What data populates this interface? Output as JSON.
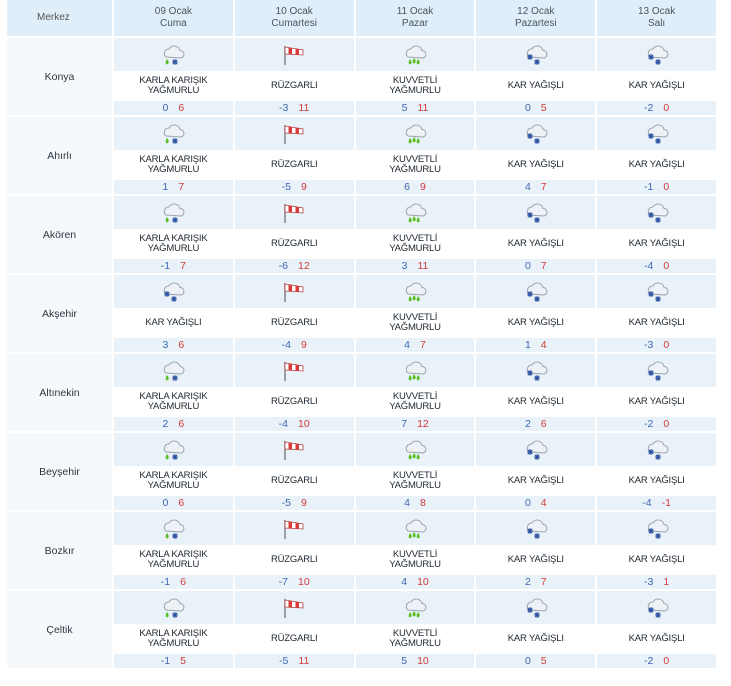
{
  "header": {
    "merkez_label": "Merkez",
    "days": [
      {
        "date": "09 Ocak",
        "weekday": "Cuma"
      },
      {
        "date": "10 Ocak",
        "weekday": "Cumartesi"
      },
      {
        "date": "11 Ocak",
        "weekday": "Pazar"
      },
      {
        "date": "12 Ocak",
        "weekday": "Pazartesi"
      },
      {
        "date": "13 Ocak",
        "weekday": "Salı"
      }
    ]
  },
  "colors": {
    "header_bg": "#dfeef8",
    "row_bg": "#e9f2f9",
    "min_temp": "#3d67b0",
    "max_temp": "#d23a3a",
    "rain_green": "#5cbf2a",
    "snow_blue": "#2a4fa0",
    "windsock_red": "#d93a3a"
  },
  "cities": [
    {
      "name": "Konya",
      "days": [
        {
          "icon": "sleet-icon",
          "label": "KARLA KARIŞIK YAĞMURLU",
          "min": "0",
          "max": "6"
        },
        {
          "icon": "windsock-icon",
          "label": "RÜZGARLI",
          "min": "-3",
          "max": "11"
        },
        {
          "icon": "heavy-rain-icon",
          "label": "KUVVETLİ YAĞMURLU",
          "min": "5",
          "max": "11"
        },
        {
          "icon": "snow-icon",
          "label": "KAR YAĞIŞLI",
          "min": "0",
          "max": "5"
        },
        {
          "icon": "snow-icon",
          "label": "KAR YAĞIŞLI",
          "min": "-2",
          "max": "0"
        }
      ]
    },
    {
      "name": "Ahırlı",
      "days": [
        {
          "icon": "sleet-icon",
          "label": "KARLA KARIŞIK YAĞMURLU",
          "min": "1",
          "max": "7"
        },
        {
          "icon": "windsock-icon",
          "label": "RÜZGARLI",
          "min": "-5",
          "max": "9"
        },
        {
          "icon": "heavy-rain-icon",
          "label": "KUVVETLİ YAĞMURLU",
          "min": "6",
          "max": "9"
        },
        {
          "icon": "snow-icon",
          "label": "KAR YAĞIŞLI",
          "min": "4",
          "max": "7"
        },
        {
          "icon": "snow-icon",
          "label": "KAR YAĞIŞLI",
          "min": "-1",
          "max": "0"
        }
      ]
    },
    {
      "name": "Akören",
      "days": [
        {
          "icon": "sleet-icon",
          "label": "KARLA KARIŞIK YAĞMURLU",
          "min": "-1",
          "max": "7"
        },
        {
          "icon": "windsock-icon",
          "label": "RÜZGARLI",
          "min": "-6",
          "max": "12"
        },
        {
          "icon": "heavy-rain-icon",
          "label": "KUVVETLİ YAĞMURLU",
          "min": "3",
          "max": "11"
        },
        {
          "icon": "snow-icon",
          "label": "KAR YAĞIŞLI",
          "min": "0",
          "max": "7"
        },
        {
          "icon": "snow-icon",
          "label": "KAR YAĞIŞLI",
          "min": "-4",
          "max": "0"
        }
      ]
    },
    {
      "name": "Akşehir",
      "days": [
        {
          "icon": "snow-icon",
          "label": "KAR YAĞIŞLI",
          "min": "3",
          "max": "6"
        },
        {
          "icon": "windsock-icon",
          "label": "RÜZGARLI",
          "min": "-4",
          "max": "9"
        },
        {
          "icon": "heavy-rain-icon",
          "label": "KUVVETLİ YAĞMURLU",
          "min": "4",
          "max": "7"
        },
        {
          "icon": "snow-icon",
          "label": "KAR YAĞIŞLI",
          "min": "1",
          "max": "4"
        },
        {
          "icon": "snow-icon",
          "label": "KAR YAĞIŞLI",
          "min": "-3",
          "max": "0"
        }
      ]
    },
    {
      "name": "Altınekin",
      "days": [
        {
          "icon": "sleet-icon",
          "label": "KARLA KARIŞIK YAĞMURLU",
          "min": "2",
          "max": "6"
        },
        {
          "icon": "windsock-icon",
          "label": "RÜZGARLI",
          "min": "-4",
          "max": "10"
        },
        {
          "icon": "heavy-rain-icon",
          "label": "KUVVETLİ YAĞMURLU",
          "min": "7",
          "max": "12"
        },
        {
          "icon": "snow-icon",
          "label": "KAR YAĞIŞLI",
          "min": "2",
          "max": "6"
        },
        {
          "icon": "snow-icon",
          "label": "KAR YAĞIŞLI",
          "min": "-2",
          "max": "0"
        }
      ]
    },
    {
      "name": "Beyşehir",
      "days": [
        {
          "icon": "sleet-icon",
          "label": "KARLA KARIŞIK YAĞMURLU",
          "min": "0",
          "max": "6"
        },
        {
          "icon": "windsock-icon",
          "label": "RÜZGARLI",
          "min": "-5",
          "max": "9"
        },
        {
          "icon": "heavy-rain-icon",
          "label": "KUVVETLİ YAĞMURLU",
          "min": "4",
          "max": "8"
        },
        {
          "icon": "snow-icon",
          "label": "KAR YAĞIŞLI",
          "min": "0",
          "max": "4"
        },
        {
          "icon": "snow-icon",
          "label": "KAR YAĞIŞLI",
          "min": "-4",
          "max": "-1"
        }
      ]
    },
    {
      "name": "Bozkır",
      "days": [
        {
          "icon": "sleet-icon",
          "label": "KARLA KARIŞIK YAĞMURLU",
          "min": "-1",
          "max": "6"
        },
        {
          "icon": "windsock-icon",
          "label": "RÜZGARLI",
          "min": "-7",
          "max": "10"
        },
        {
          "icon": "heavy-rain-icon",
          "label": "KUVVETLİ YAĞMURLU",
          "min": "4",
          "max": "10"
        },
        {
          "icon": "snow-icon",
          "label": "KAR YAĞIŞLI",
          "min": "2",
          "max": "7"
        },
        {
          "icon": "snow-icon",
          "label": "KAR YAĞIŞLI",
          "min": "-3",
          "max": "1"
        }
      ]
    },
    {
      "name": "Çeltik",
      "days": [
        {
          "icon": "sleet-icon",
          "label": "KARLA KARIŞIK YAĞMURLU",
          "min": "-1",
          "max": "5"
        },
        {
          "icon": "windsock-icon",
          "label": "RÜZGARLI",
          "min": "-5",
          "max": "11"
        },
        {
          "icon": "heavy-rain-icon",
          "label": "KUVVETLİ YAĞMURLU",
          "min": "5",
          "max": "10"
        },
        {
          "icon": "snow-icon",
          "label": "KAR YAĞIŞLI",
          "min": "0",
          "max": "5"
        },
        {
          "icon": "snow-icon",
          "label": "KAR YAĞIŞLI",
          "min": "-2",
          "max": "0"
        }
      ]
    }
  ]
}
